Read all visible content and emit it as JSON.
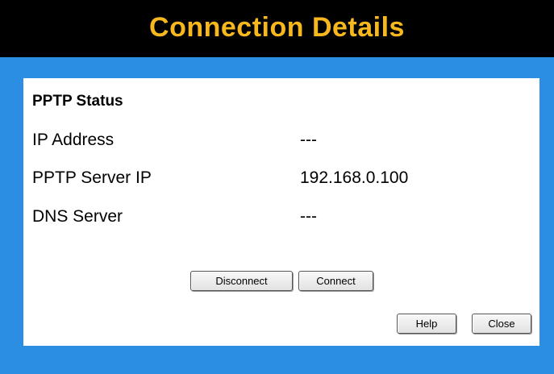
{
  "header": {
    "title": "Connection Details"
  },
  "panel": {
    "section_title": "PPTP Status",
    "fields": [
      {
        "label": "IP Address",
        "value": "---"
      },
      {
        "label": "PPTP Server IP",
        "value": "192.168.0.100"
      },
      {
        "label": "DNS Server",
        "value": "---"
      }
    ]
  },
  "buttons": {
    "disconnect": "Disconnect",
    "connect": "Connect",
    "help": "Help",
    "close": "Close"
  },
  "colors": {
    "background": "#2c8ee3",
    "header_bg": "#000000",
    "title_color": "#f6b81c",
    "panel_bg": "#ffffff"
  }
}
